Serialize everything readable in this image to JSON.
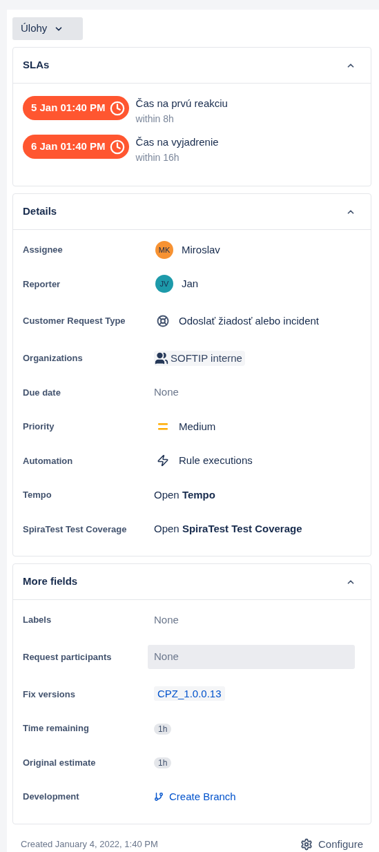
{
  "dropdown": {
    "label": "Úlohy"
  },
  "slas": {
    "title": "SLAs",
    "expanded": true,
    "items": [
      {
        "badge": "5 Jan 01:40 PM",
        "name": "Čas na prvú reakciu",
        "goal": "within 8h"
      },
      {
        "badge": "6 Jan 01:40 PM",
        "name": "Čas na vyjadrenie",
        "goal": "within 16h"
      }
    ]
  },
  "details": {
    "title": "Details",
    "expanded": true,
    "fields": [
      {
        "label": "Assignee",
        "kind": "avatar",
        "initials": "MK",
        "color": "#f79232",
        "value": "Miroslav"
      },
      {
        "label": "Reporter",
        "kind": "avatar",
        "initials": "JV",
        "color": "#1d9aaa",
        "value": "Jan"
      },
      {
        "label": "Customer Request Type",
        "kind": "request_type",
        "value": "Odoslať žiadosť alebo incident"
      },
      {
        "label": "Organizations",
        "kind": "organization",
        "value": "SOFTIP interne"
      },
      {
        "label": "Due date",
        "kind": "empty",
        "value": "None"
      },
      {
        "label": "Priority",
        "kind": "priority",
        "value": "Medium"
      },
      {
        "label": "Automation",
        "kind": "automation",
        "value": "Rule executions"
      },
      {
        "label": "Tempo",
        "kind": "open",
        "value": "Open **Tempo**"
      },
      {
        "label": "SpiraTest Test Coverage",
        "kind": "open",
        "value": "Open **SpiraTest Test Coverage**"
      }
    ]
  },
  "more_fields": {
    "title": "More fields",
    "expanded": true,
    "fields": [
      {
        "label": "Labels",
        "kind": "empty",
        "value": "None"
      },
      {
        "label": "Request participants",
        "kind": "input",
        "value": "None"
      },
      {
        "label": "Fix versions",
        "kind": "version",
        "value": "CPZ_1.0.0.13"
      },
      {
        "label": "Time remaining",
        "kind": "lozenge",
        "value": "1h"
      },
      {
        "label": "Original estimate",
        "kind": "lozenge",
        "value": "1h"
      },
      {
        "label": "Development",
        "kind": "branch",
        "value": "Create Branch"
      }
    ]
  },
  "footer": {
    "created": "Created January 4, 2022, 1:40 PM",
    "configure": "Configure"
  }
}
